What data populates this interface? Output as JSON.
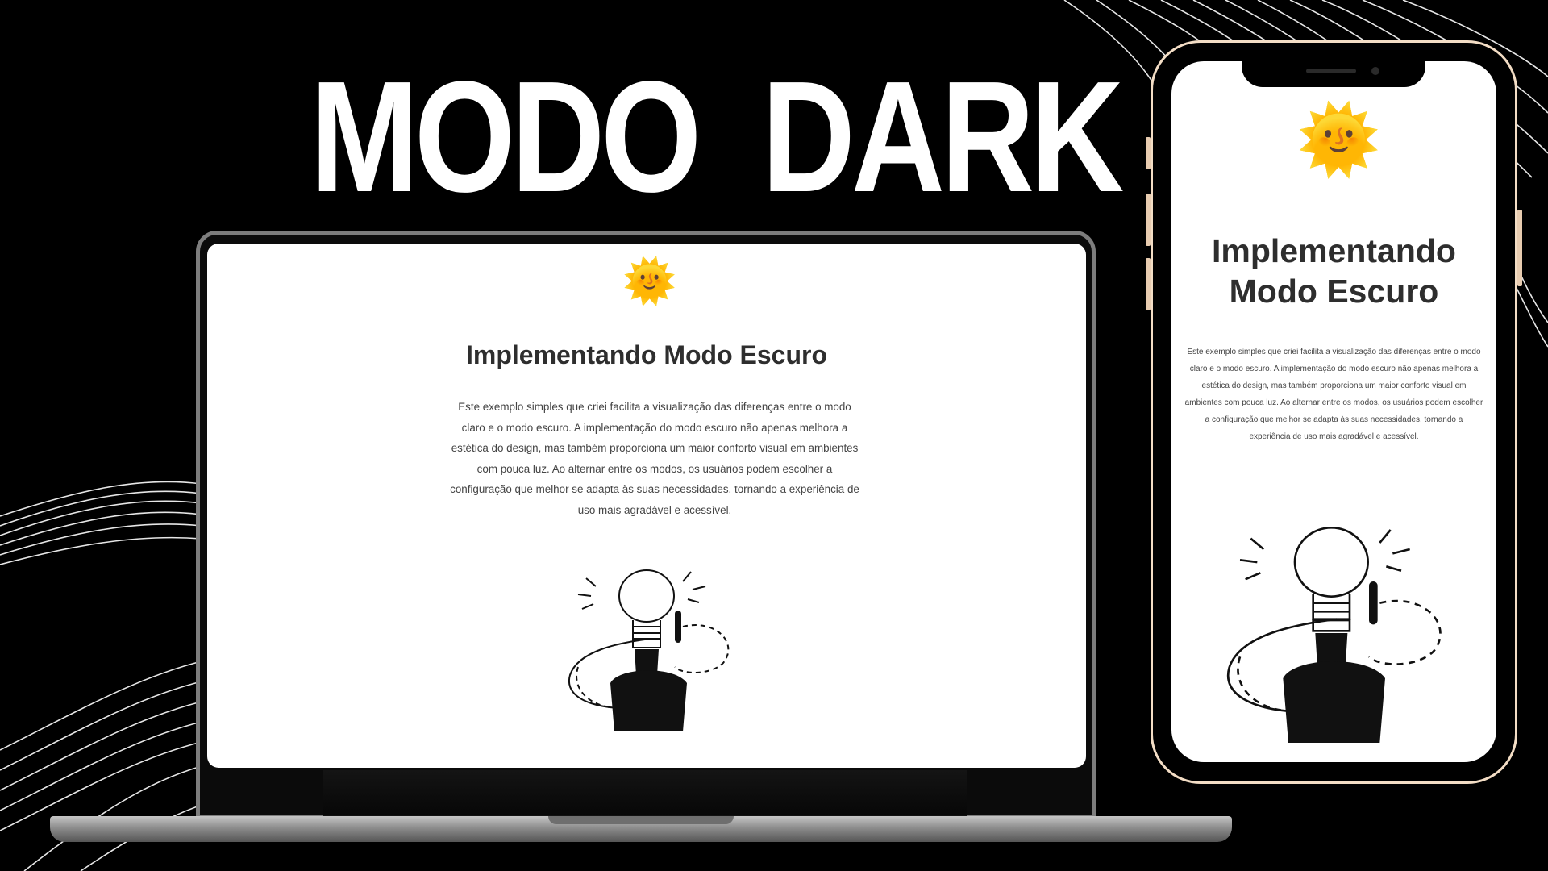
{
  "headline": "MODO  DARK",
  "page": {
    "icon": "sun-face-emoji",
    "sun_glyph": "🌞",
    "title": "Implementando Modo Escuro",
    "description": "Este exemplo simples que criei facilita a visualização das diferenças entre o modo claro e o modo escuro. A implementação do modo escuro não apenas melhora a estética do design, mas também proporciona um maior conforto visual em ambientes com pouca luz. Ao alternar entre os modos, os usuários podem escolher a configuração que melhor se adapta às suas necessidades, tornando a experiência de uso mais agradável e acessível.",
    "illustration": "man-with-lightbulb-head-illustration"
  },
  "phone": {
    "title_line1": "Implementando",
    "title_line2": "Modo Escuro"
  },
  "colors": {
    "background": "#000000",
    "headline": "#ffffff",
    "screen": "#ffffff",
    "title_text": "#2e2e2e",
    "phone_frame": "#f3ddc5"
  }
}
